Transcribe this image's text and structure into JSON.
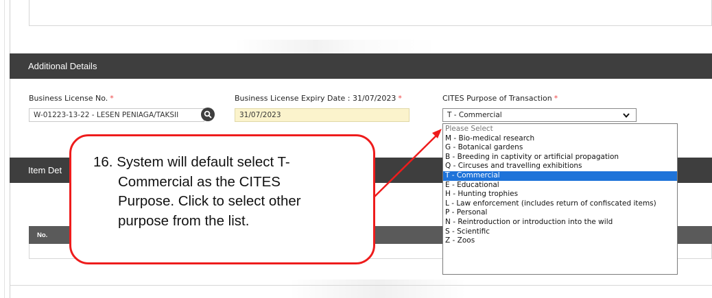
{
  "additional_details": {
    "header": "Additional Details",
    "business_license": {
      "label": "Business License No.",
      "required_mark": "*",
      "value": "W-01223-13-22 - LESEN PENIAGA/TAKSII"
    },
    "expiry": {
      "label": "Business License Expiry Date : 31/07/2023",
      "required_mark": "*",
      "value": "31/07/2023"
    },
    "cites_purpose": {
      "label": "CITES Purpose of Transaction",
      "required_mark": "*",
      "selected": "T - Commercial",
      "options": [
        "Please Select",
        "M - Bio-medical research",
        "G - Botanical gardens",
        "B - Breeding in captivity or artificial propagation",
        "Q - Circuses and travelling exhibitions",
        "T - Commercial",
        "E - Educational",
        "H - Hunting trophies",
        "L - Law enforcement (includes return of confiscated items)",
        "P - Personal",
        "N - Reintroduction or introduction into the wild",
        "S - Scientific",
        "Z - Zoos"
      ]
    }
  },
  "item_details": {
    "header": "Item Det",
    "table": {
      "col_no": "No."
    }
  },
  "callout": {
    "lines": [
      "16. System will default select T-",
      "Commercial as the CITES",
      "Purpose. Click to select other",
      "purpose from the list."
    ]
  },
  "colors": {
    "header_bg": "#3e3e3e",
    "selected_option": "#1e73d9",
    "callout_border": "#ee1c1c",
    "expiry_bg": "#fbf3cc"
  },
  "icons": {
    "search": "search-icon",
    "chevron": "chevron-down-icon"
  }
}
